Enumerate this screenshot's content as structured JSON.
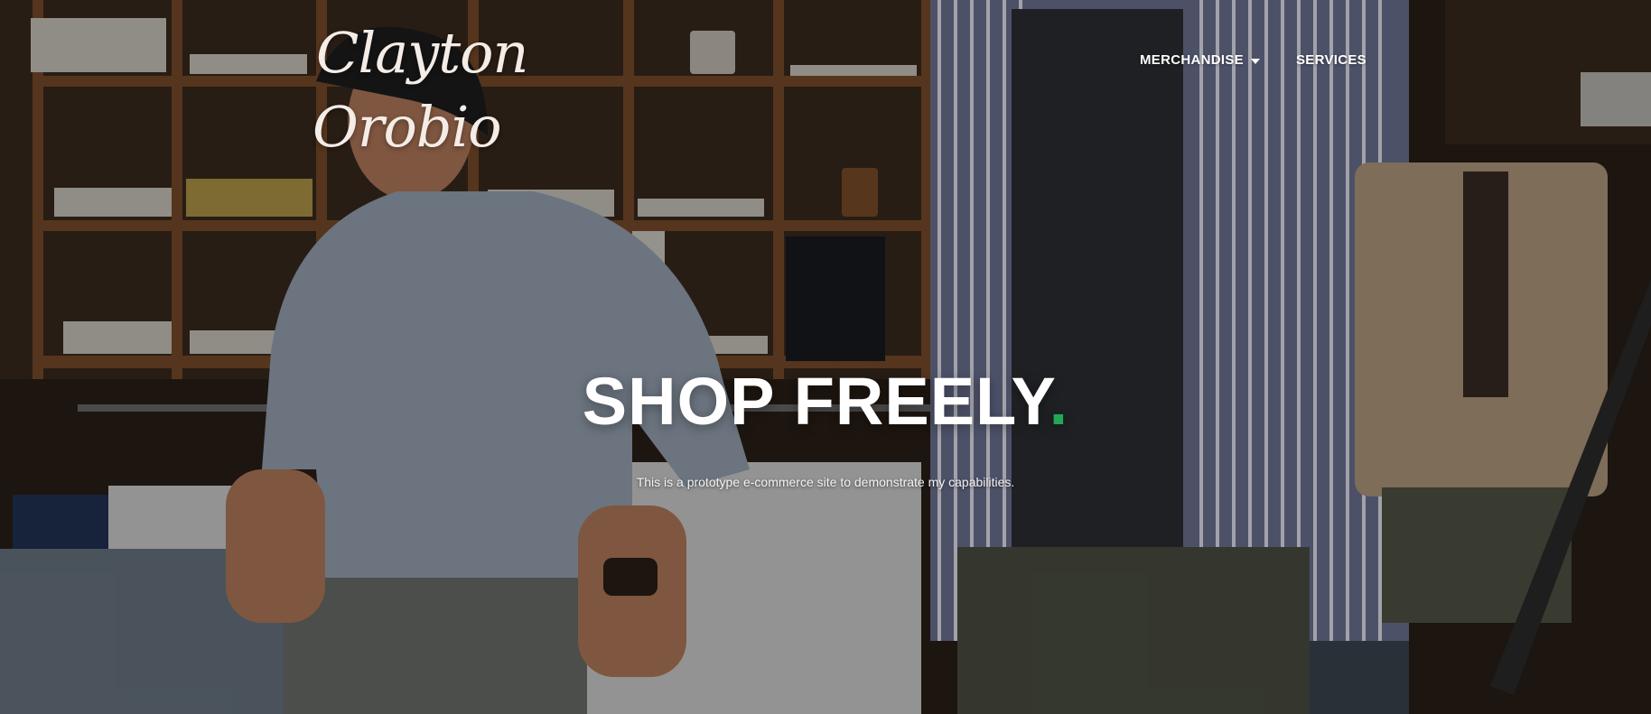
{
  "brand": {
    "logo_line1": "Clayton",
    "logo_line2": "Orobio"
  },
  "nav": {
    "merchandise": "MERCHANDISE",
    "services": "SERVICES"
  },
  "hero": {
    "headline": "SHOP FREELY",
    "headline_dot": ".",
    "tagline": "This is a prototype e-commerce site to demonstrate my capabilities."
  },
  "colors": {
    "accent_green": "#22a855",
    "text_white": "#ffffff"
  },
  "icons": {
    "merchandise_dropdown": "caret-down-icon"
  }
}
